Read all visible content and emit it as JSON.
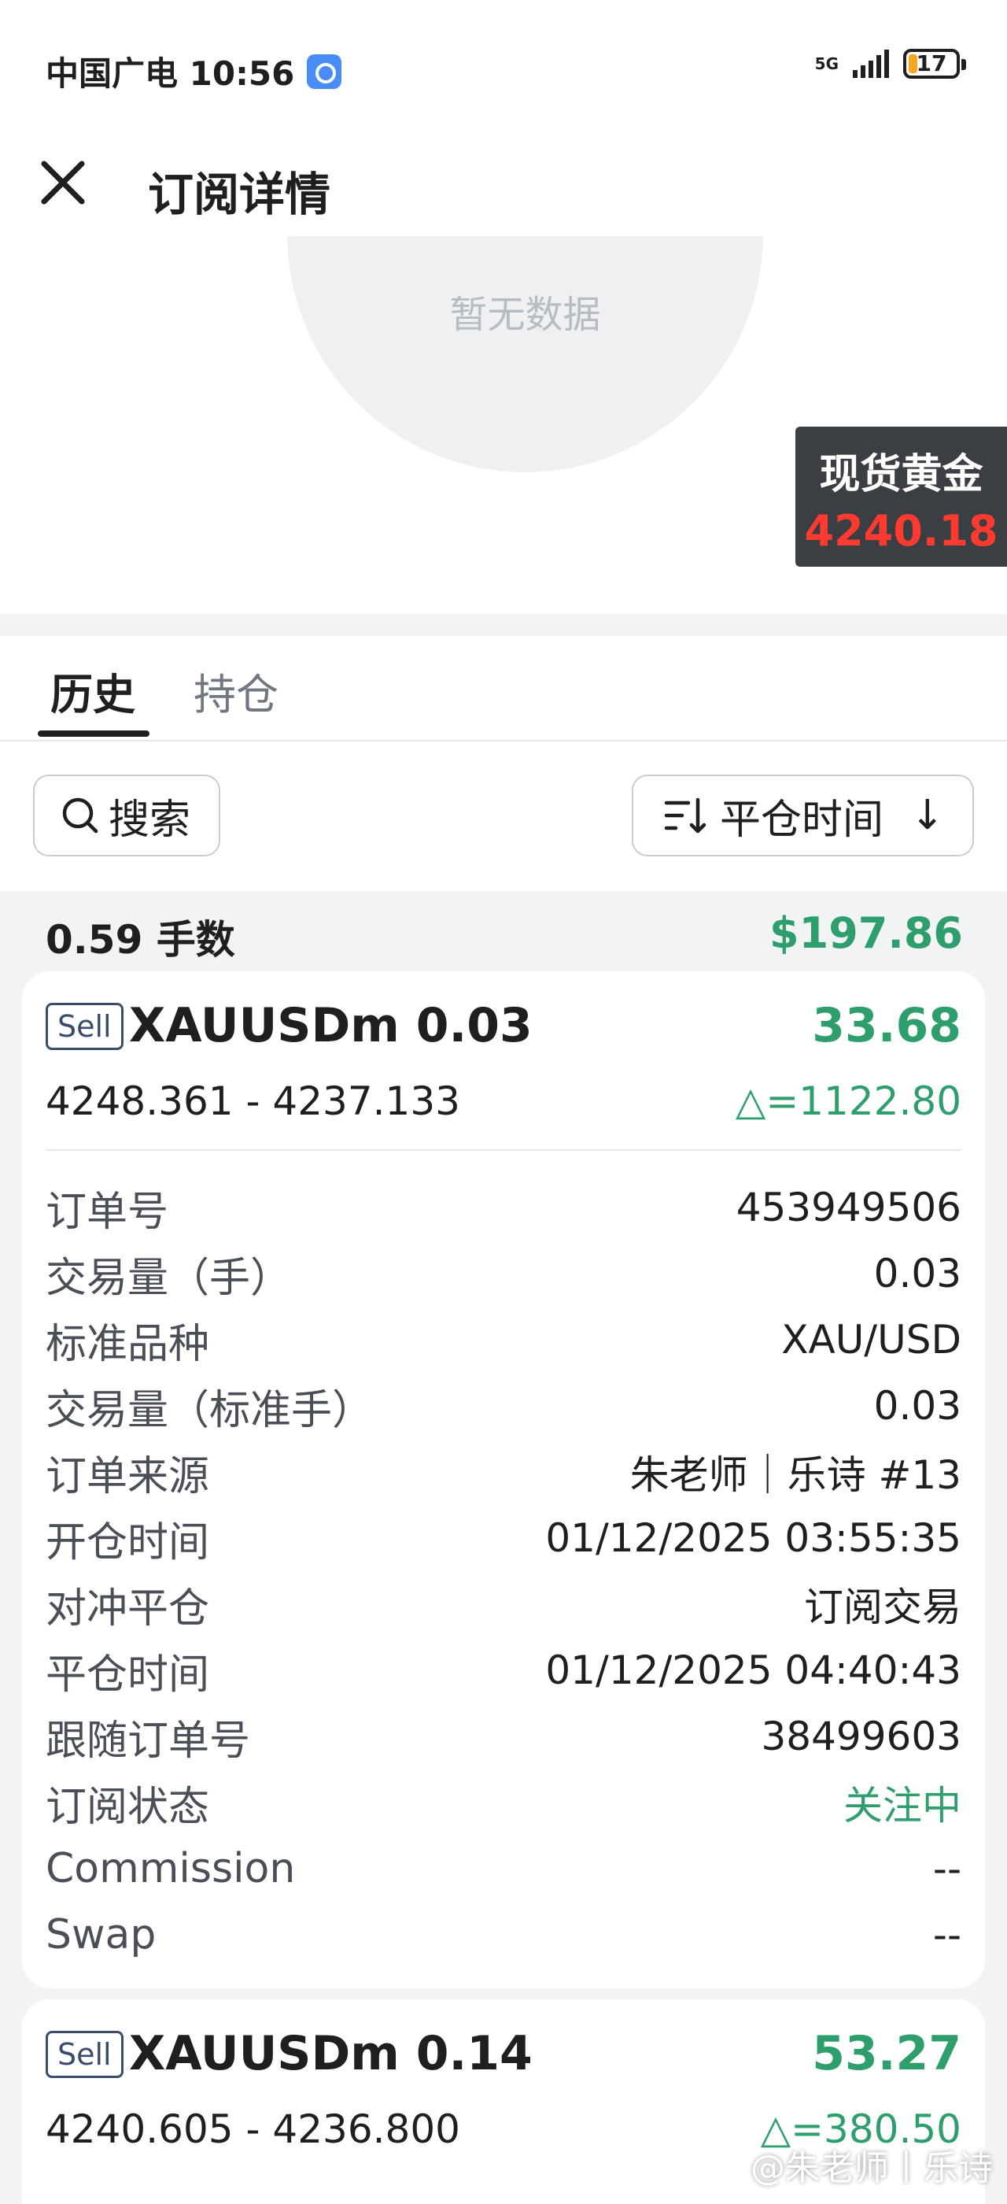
{
  "status_bar": {
    "carrier_time": "中国广电 10:56",
    "network": "5G",
    "battery": "17",
    "battery_level": 0.17,
    "battery_color": "#f5a623"
  },
  "header": {
    "close_icon": "close-icon",
    "title": "订阅详情"
  },
  "chart": {
    "empty_text": "暂无数据",
    "badge_name": "现货黄金",
    "badge_price": "4240.18",
    "badge_price_color": "#ff3b30"
  },
  "tabs": [
    {
      "label": "历史",
      "active": true
    },
    {
      "label": "持仓",
      "active": false
    }
  ],
  "toolbar": {
    "search_icon": "search-icon",
    "search_label": "搜索",
    "sort_icon": "sort-icon",
    "sort_label": "平仓时间",
    "sort_direction": "↓"
  },
  "summary": {
    "lots": "0.59 手数",
    "total_profit": "$197.86",
    "profit_color": "#2e9e6d"
  },
  "orders": [
    {
      "side": "Sell",
      "symbol": "XAUUSDm 0.03",
      "profit": "33.68",
      "price_range": "4248.361 - 4237.133",
      "points": "△=1122.80",
      "details": [
        {
          "label": "订单号",
          "value": "453949506"
        },
        {
          "label": "交易量（手）",
          "value": "0.03"
        },
        {
          "label": "标准品种",
          "value": "XAU/USD"
        },
        {
          "label": "交易量（标准手）",
          "value": "0.03"
        },
        {
          "label": "订单来源",
          "value": "朱老师｜乐诗 #13"
        },
        {
          "label": "开仓时间",
          "value": "01/12/2025 03:55:35"
        },
        {
          "label": "对冲平仓",
          "value": "订阅交易"
        },
        {
          "label": "平仓时间",
          "value": "01/12/2025 04:40:43"
        },
        {
          "label": "跟随订单号",
          "value": "38499603"
        },
        {
          "label": "订阅状态",
          "value": "关注中"
        },
        {
          "label": "Commission",
          "value": "--"
        },
        {
          "label": "Swap",
          "value": "--"
        }
      ]
    },
    {
      "side": "Sell",
      "symbol": "XAUUSDm 0.14",
      "profit": "53.27",
      "price_range": "4240.605 - 4236.800",
      "points": "△=380.50"
    }
  ],
  "watermark": "@朱老师丨乐诗"
}
